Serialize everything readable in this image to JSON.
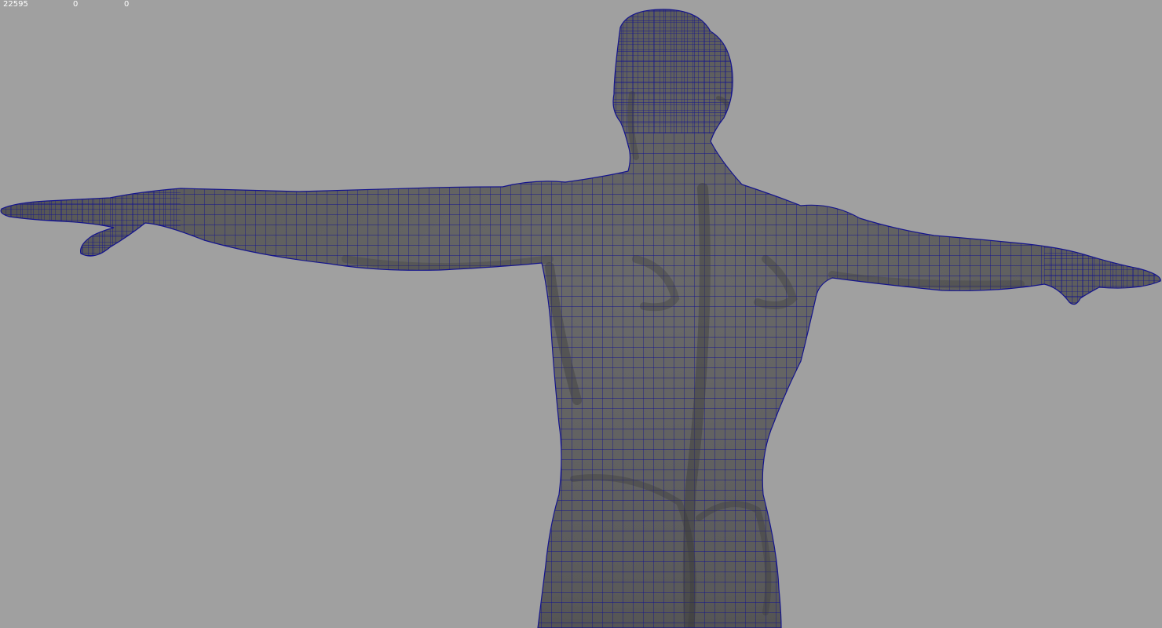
{
  "viewport": {
    "background_color": "#a0a0a0",
    "wire_color": "#14148c",
    "shade_color": "#5a5a5a",
    "hud": {
      "values": [
        "22595",
        "0",
        "0"
      ]
    },
    "model": {
      "name": "",
      "pose": "T-pose",
      "view": "rear"
    }
  }
}
